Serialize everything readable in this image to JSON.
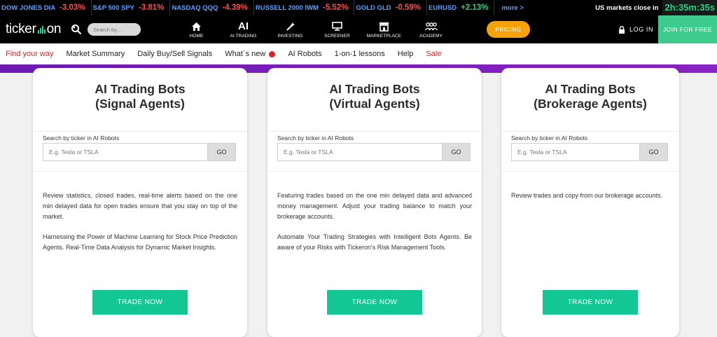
{
  "ticker": [
    {
      "name": "DOW JONES DIA",
      "value": "-3.03%",
      "dir": "neg"
    },
    {
      "name": "S&P 500 SPY",
      "value": "-3.81%",
      "dir": "neg"
    },
    {
      "name": "NASDAQ QQQ",
      "value": "-4.39%",
      "dir": "neg"
    },
    {
      "name": "RUSSELL 2000 IWM",
      "value": "-5.52%",
      "dir": "neg"
    },
    {
      "name": "GOLD GLD",
      "value": "-0.59%",
      "dir": "neg"
    },
    {
      "name": "EURUSD",
      "value": "+2.13%",
      "dir": "pos"
    }
  ],
  "ticker_more": "more >",
  "market_close_label": "US markets close in",
  "market_close_timer": "2h:35m:35s",
  "header": {
    "logo_left": "ticker",
    "logo_right": "on",
    "search_placeholder": "Search by...",
    "nav": [
      {
        "label": "HOME",
        "icon": "home-icon"
      },
      {
        "label": "AI TRADING",
        "icon": "ai-icon"
      },
      {
        "label": "INVESTING",
        "icon": "wand-icon"
      },
      {
        "label": "SCREENER",
        "icon": "monitor-icon"
      },
      {
        "label": "MARKETPLACE",
        "icon": "store-icon"
      },
      {
        "label": "ACADEMY",
        "icon": "users-icon"
      }
    ],
    "ai_text": "AI",
    "pricing": "PRICING",
    "login": "LOG IN",
    "join": "JOIN FOR FREE"
  },
  "subnav": [
    "Find your way",
    "Market Summary",
    "Daily Buy/Sell Signals",
    "What`s new",
    "AI Robots",
    "1-on-1 lessons",
    "Help",
    "Sale"
  ],
  "cards": [
    {
      "title_line1": "AI Trading Bots",
      "title_line2": "(Signal Agents)",
      "search_label": "Search by ticker in AI Robots",
      "input_placeholder": "E.g. Tesla or TSLA",
      "go": "GO",
      "paragraphs": [
        "Review statistics, closed trades, real-time alerts based on the one min delayed data for open trades ensure that you stay on top of the market.",
        "Harnessing the Power of Machine Learning for Stock Price Prediction Agents. Real-Time Data Analysis for Dynamic Market Insights."
      ],
      "button": "TRADE NOW"
    },
    {
      "title_line1": "AI Trading Bots",
      "title_line2": "(Virtual Agents)",
      "search_label": "Search by ticker in AI Robots",
      "input_placeholder": "E.g. Tesla or TSLA",
      "go": "GO",
      "paragraphs": [
        "Featuring trades based on the one min delayed data and advanced money management. Adjust your trading balance to match your brokerage accounts.",
        "Automate Your Trading Strategies with Intelligent Bots Agents. Be aware of your Risks with Tickeron's Risk Management Tools."
      ],
      "button": "TRADE NOW"
    },
    {
      "title_line1": "AI Trading Bots",
      "title_line2": "(Brokerage Agents)",
      "search_label": "Search by ticker in AI Robots",
      "input_placeholder": "E.g. Tesla or TSLA",
      "go": "GO",
      "paragraphs": [
        "Review trades and copy from our brokerage accounts."
      ],
      "button": "TRADE NOW"
    }
  ],
  "colors": {
    "accent_green": "#12c794",
    "pricing_orange": "#f7a208",
    "negative_red": "#ff4d4d",
    "positive_green": "#22d48b",
    "purple_strip": "#7a1fbf"
  }
}
